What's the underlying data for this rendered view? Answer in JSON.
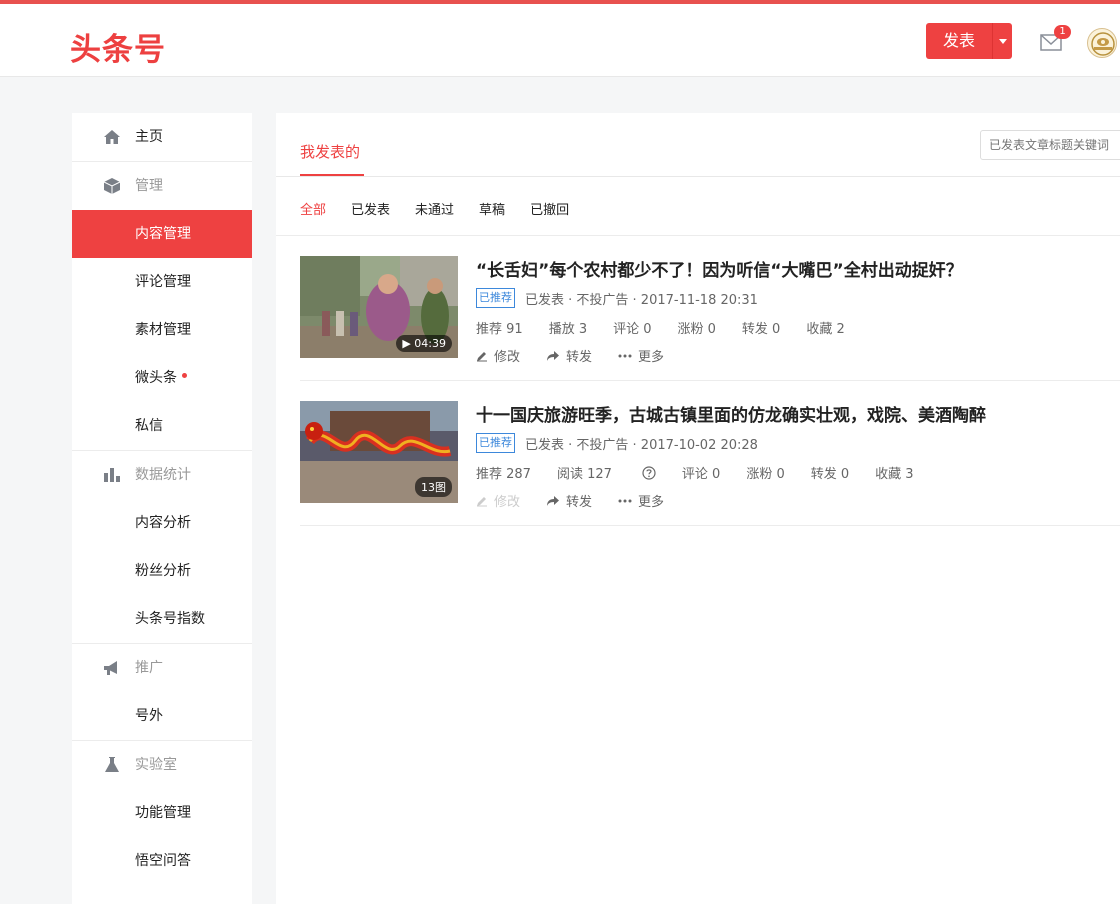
{
  "header": {
    "logo": "头条号",
    "publish_label": "发表",
    "mail_count": "1"
  },
  "sidebar": {
    "items": [
      {
        "label": "主页",
        "icon": "home-icon"
      },
      {
        "label": "管理",
        "icon": "cube-icon"
      },
      {
        "label": "内容管理"
      },
      {
        "label": "评论管理"
      },
      {
        "label": "素材管理"
      },
      {
        "label": "微头条"
      },
      {
        "label": "私信"
      },
      {
        "label": "数据统计",
        "icon": "bar-chart-icon"
      },
      {
        "label": "内容分析"
      },
      {
        "label": "粉丝分析"
      },
      {
        "label": "头条号指数"
      },
      {
        "label": "推广",
        "icon": "megaphone-icon"
      },
      {
        "label": "号外"
      },
      {
        "label": "实验室",
        "icon": "flask-icon"
      },
      {
        "label": "功能管理"
      },
      {
        "label": "悟空问答"
      }
    ]
  },
  "main": {
    "tab": "我发表的",
    "search_placeholder": "已发表文章标题关键词",
    "filters": [
      "全部",
      "已发表",
      "未通过",
      "草稿",
      "已撤回"
    ],
    "articles": [
      {
        "title": "“长舌妇”每个农村都少不了！因为听信“大嘴巴”全村出动捉奸？",
        "badge": "已推荐",
        "meta": "已发表 · 不投广告 · 2017-11-18 20:31",
        "thumb_tag": "04:39",
        "stats": [
          "推荐 91",
          "播放 3",
          "评论 0",
          "涨粉 0",
          "转发 0",
          "收藏 2"
        ],
        "actions": [
          "修改",
          "转发",
          "更多"
        ]
      },
      {
        "title": "十一国庆旅游旺季，古城古镇里面的仿龙确实壮观，戏院、美酒陶醉",
        "badge": "已推荐",
        "meta": "已发表 · 不投广告 · 2017-10-02 20:28",
        "thumb_tag": "13图",
        "stats": [
          "推荐 287",
          "阅读 127",
          "评论 0",
          "涨粉 0",
          "转发 0",
          "收藏 3"
        ],
        "actions": [
          "修改",
          "转发",
          "更多"
        ]
      }
    ]
  },
  "colors": {
    "accent": "#ee4141",
    "link_blue": "#3d88db"
  }
}
